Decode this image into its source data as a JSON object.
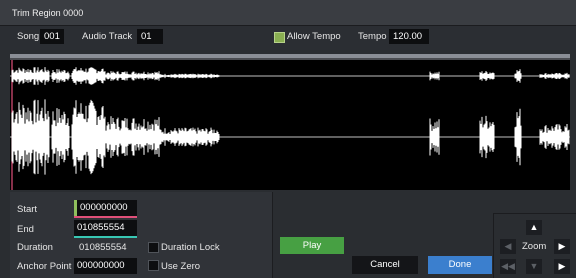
{
  "window": {
    "title": "Trim Region 0000"
  },
  "top": {
    "song_label": "Song",
    "song_value": "001",
    "track_label": "Audio Track",
    "track_value": "01",
    "allow_tempo_label": "Allow Tempo",
    "allow_tempo_checked": true,
    "tempo_label": "Tempo",
    "tempo_value": "120.00"
  },
  "fields": {
    "start_label": "Start",
    "start_value": "000000000",
    "end_label": "End",
    "end_value": "010855554",
    "duration_label": "Duration",
    "duration_value": "010855554",
    "anchor_label": "Anchor Point",
    "anchor_value": "000000000"
  },
  "options": {
    "duration_lock_label": "Duration Lock",
    "duration_lock_checked": false,
    "use_zero_label": "Use Zero",
    "use_zero_checked": false
  },
  "buttons": {
    "play": "Play",
    "cancel": "Cancel",
    "done": "Done"
  },
  "zoom": {
    "label": "Zoom"
  },
  "colors": {
    "start_marker": "#8fbf5d",
    "end_marker": "#e0507a",
    "duration_marker": "#38c8b4",
    "play": "#47a043",
    "done": "#3b7fce",
    "waveform": "#ffffff",
    "playhead": "#e0507a"
  }
}
